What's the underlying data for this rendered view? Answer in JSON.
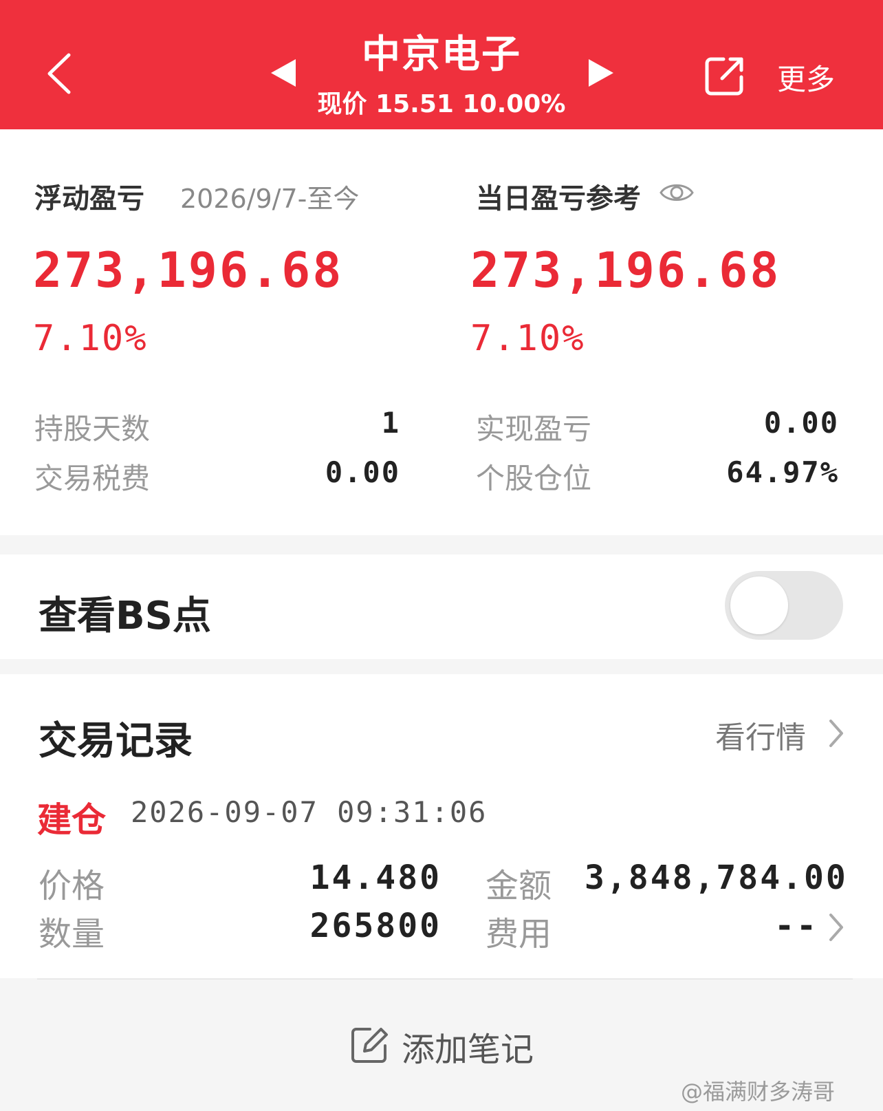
{
  "header": {
    "title": "中京电子",
    "subtitle": "现价 15.51 10.00%",
    "more_label": "更多"
  },
  "pnl": {
    "floating_label": "浮动盈亏",
    "floating_period": "2026/9/7-至今",
    "floating_value": "273,196.68",
    "floating_pct": "7.10%",
    "daily_label": "当日盈亏参考",
    "daily_value": "273,196.68",
    "daily_pct": "7.10%"
  },
  "stats": {
    "hold_days_label": "持股天数",
    "hold_days_value": "1",
    "fee_label": "交易税费",
    "fee_value": "0.00",
    "realized_label": "实现盈亏",
    "realized_value": "0.00",
    "position_label": "个股仓位",
    "position_value": "64.97%"
  },
  "bs": {
    "label": "查看BS点",
    "enabled": false
  },
  "records": {
    "title": "交易记录",
    "market_link": "看行情",
    "items": [
      {
        "type": "建仓",
        "time": "2026-09-07 09:31:06",
        "price_label": "价格",
        "price": "14.480",
        "amount_label": "金额",
        "amount": "3,848,784.00",
        "qty_label": "数量",
        "qty": "265800",
        "cost_label": "费用",
        "cost": "--"
      }
    ]
  },
  "footer": {
    "add_note_label": "添加笔记",
    "watermark": "@福满财多涛哥"
  },
  "colors": {
    "brand_red": "#ef303d",
    "profit_red": "#ea2a36"
  }
}
